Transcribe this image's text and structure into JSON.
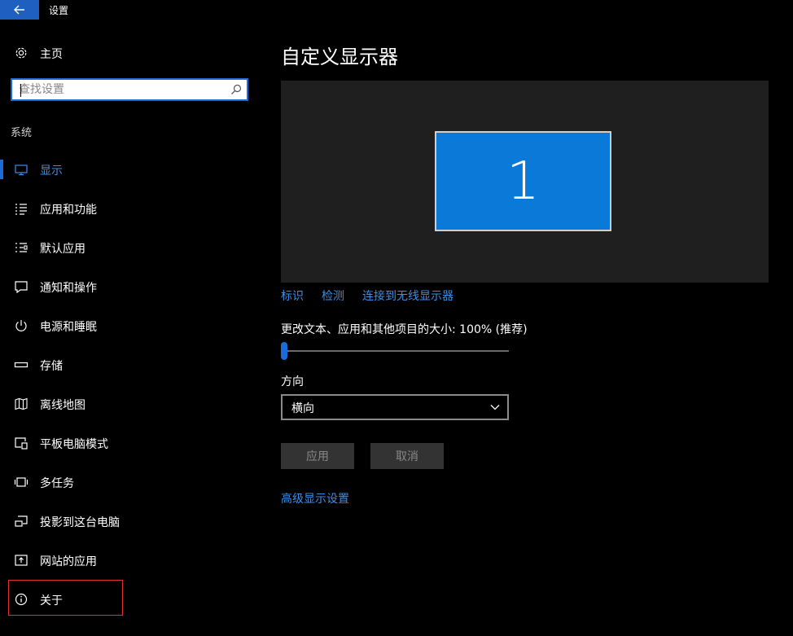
{
  "window": {
    "title": "设置",
    "back_icon": "back-arrow-icon"
  },
  "sidebar": {
    "home": {
      "label": "主页",
      "icon": "gear-icon"
    },
    "search": {
      "placeholder": "查找设置",
      "value": "",
      "icon": "search-icon"
    },
    "section_header": "系统",
    "items": [
      {
        "label": "显示",
        "icon": "monitor-icon",
        "active": true
      },
      {
        "label": "应用和功能",
        "icon": "apps-list-icon",
        "active": false
      },
      {
        "label": "默认应用",
        "icon": "default-apps-icon",
        "active": false
      },
      {
        "label": "通知和操作",
        "icon": "notification-icon",
        "active": false
      },
      {
        "label": "电源和睡眠",
        "icon": "power-icon",
        "active": false
      },
      {
        "label": "存储",
        "icon": "storage-icon",
        "active": false
      },
      {
        "label": "离线地图",
        "icon": "map-icon",
        "active": false
      },
      {
        "label": "平板电脑模式",
        "icon": "tablet-mode-icon",
        "active": false
      },
      {
        "label": "多任务",
        "icon": "multitasking-icon",
        "active": false
      },
      {
        "label": "投影到这台电脑",
        "icon": "project-icon",
        "active": false
      },
      {
        "label": "网站的应用",
        "icon": "web-apps-icon",
        "active": false
      },
      {
        "label": "关于",
        "icon": "info-icon",
        "active": false,
        "highlighted": true
      }
    ]
  },
  "main": {
    "title": "自定义显示器",
    "monitor_number": "1",
    "links": [
      "标识",
      "检测",
      "连接到无线显示器"
    ],
    "scale_label": "更改文本、应用和其他项目的大小: 100% (推荐)",
    "scale_slider_fraction": 0,
    "orientation_label": "方向",
    "orientation_value": "横向",
    "apply_label": "应用",
    "cancel_label": "取消",
    "advanced_link": "高级显示设置"
  },
  "colors": {
    "accent": "#1a6dd8",
    "link": "#3c8ee8",
    "monitor_tile": "#0a79d8",
    "highlight_border": "#e0322b"
  }
}
